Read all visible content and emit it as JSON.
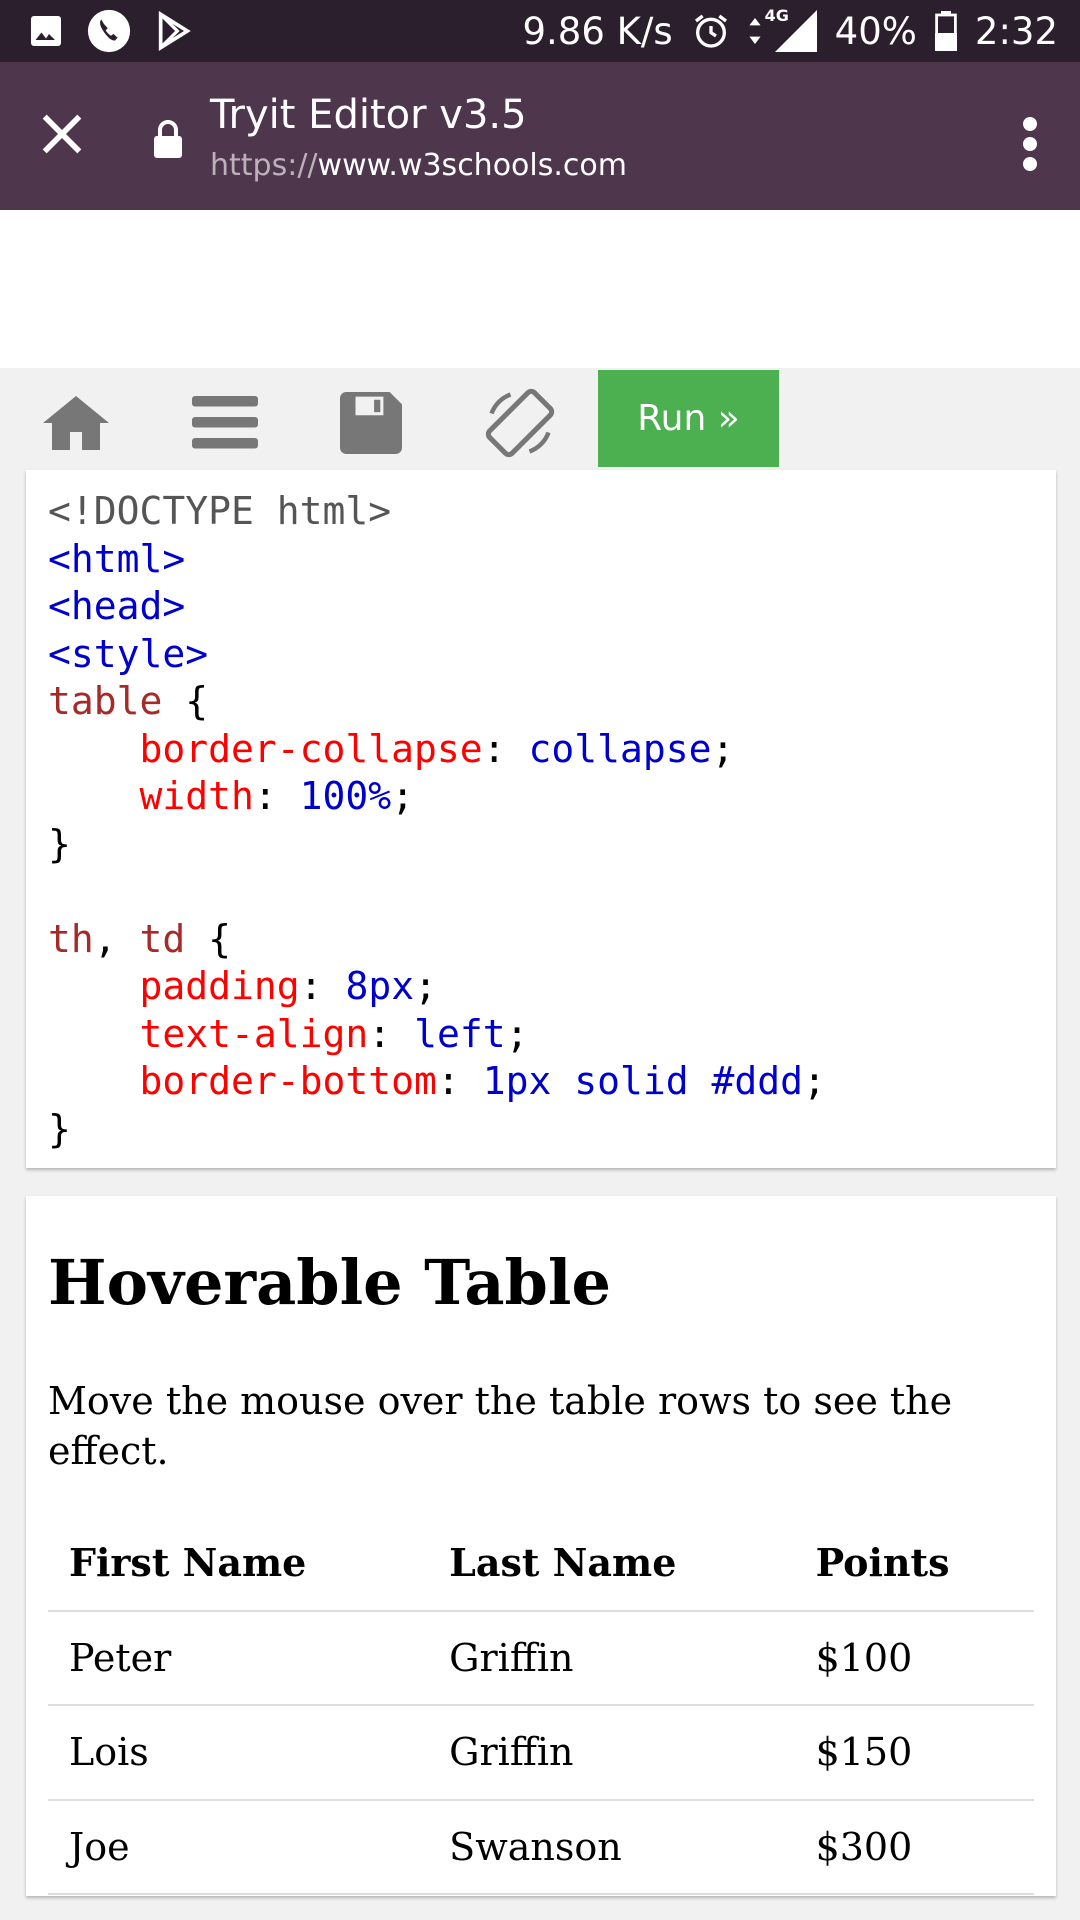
{
  "status_bar": {
    "speed": "9.86 K/s",
    "network": "4G",
    "battery": "40%",
    "time": "2:32",
    "icons": [
      "image-icon",
      "phone-icon",
      "play-store-icon",
      "alarm-icon",
      "data-arrows-icon",
      "signal-icon",
      "battery-icon"
    ]
  },
  "tab": {
    "title": "Tryit Editor v3.5",
    "url_scheme": "https://",
    "url_host": "www.w3schools.com"
  },
  "toolbar": {
    "run_label": "Run »",
    "run_color": "#4caf50"
  },
  "code": {
    "l1": "<!DOCTYPE html>",
    "l2": "<html>",
    "l3": "<head>",
    "l4": "<style>",
    "l5_sel": "table",
    "l5_br": " {",
    "l6_prop": "border-collapse",
    "l6_val": "collapse",
    "l7_prop": "width",
    "l7_val": "100%",
    "l8": "}",
    "l10_sel1": "th",
    "l10_sel2": "td",
    "l10_br": " {",
    "l11_prop": "padding",
    "l11_val": "8px",
    "l12_prop": "text-align",
    "l12_val": "left",
    "l13_prop": "border-bottom",
    "l13_val": "1px solid #ddd",
    "l14": "}"
  },
  "result": {
    "title": "Hoverable Table",
    "description": "Move the mouse over the table rows to see the effect.",
    "headers": [
      "First Name",
      "Last Name",
      "Points"
    ],
    "rows": [
      [
        "Peter",
        "Griffin",
        "$100"
      ],
      [
        "Lois",
        "Griffin",
        "$150"
      ],
      [
        "Joe",
        "Swanson",
        "$300"
      ]
    ]
  }
}
